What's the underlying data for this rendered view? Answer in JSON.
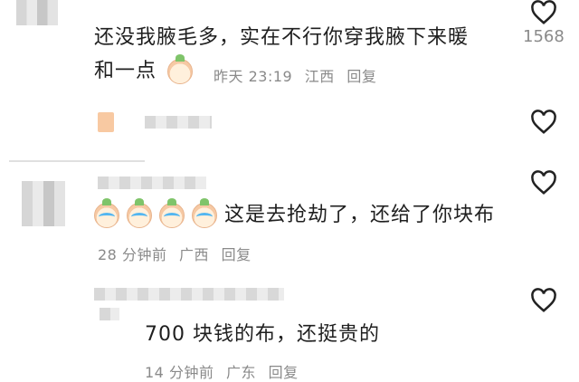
{
  "comments": [
    {
      "text_line1": "还没我腋毛多，实在不行你穿我腋下来暖",
      "text_line2": "和一点",
      "time": "昨天 23:19",
      "location": "江西",
      "reply_label": "回复",
      "likes": "1568"
    },
    {
      "text": "这是去抢劫了，还给了你块布",
      "time": "28 分钟前",
      "location": "广西",
      "reply_label": "回复"
    },
    {
      "text": "700 块钱的布，还挺贵的",
      "time": "14 分钟前",
      "location": "广东",
      "reply_label": "回复"
    }
  ],
  "icons": {
    "like": "heart-outline-icon",
    "emoji": "laughing-crying-emoji-icon"
  },
  "colors": {
    "text": "#1f1f1f",
    "meta": "#8a8a8a",
    "heart": "#222222"
  }
}
